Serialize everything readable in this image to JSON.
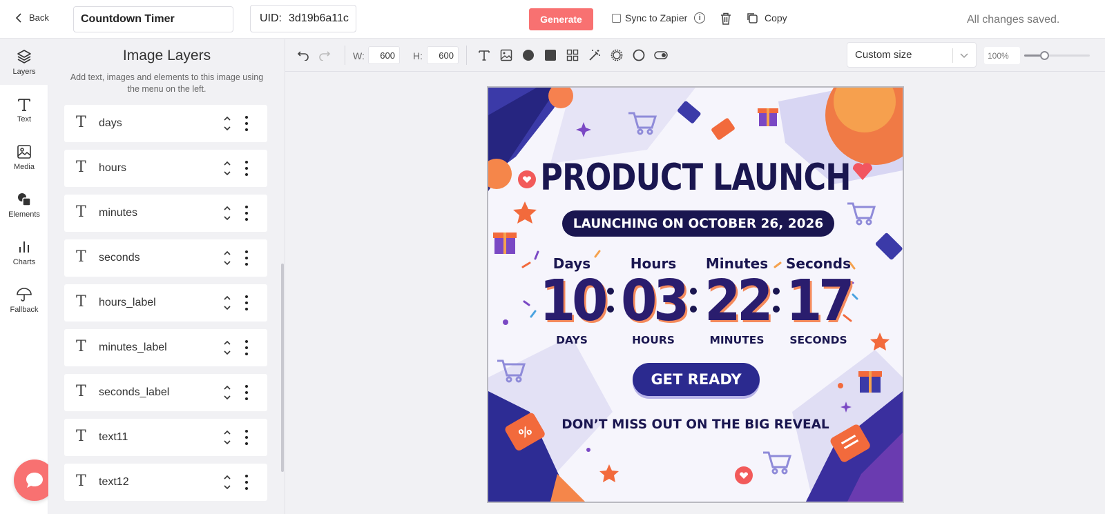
{
  "topbar": {
    "back_label": "Back",
    "title_value": "Countdown Timer",
    "uid_label": "UID:",
    "uid_value": "3d19b6a11c",
    "generate_label": "Generate",
    "sync_label": "Sync to Zapier",
    "copy_label": "Copy",
    "status": "All changes saved.",
    "accent_color": "#f87171"
  },
  "rail": {
    "items": [
      {
        "label": "Layers",
        "icon": "layers-icon"
      },
      {
        "label": "Text",
        "icon": "text-icon"
      },
      {
        "label": "Media",
        "icon": "image-icon"
      },
      {
        "label": "Elements",
        "icon": "shapes-icon"
      },
      {
        "label": "Charts",
        "icon": "bar-chart-icon"
      },
      {
        "label": "Fallback",
        "icon": "umbrella-icon"
      }
    ]
  },
  "panel": {
    "title": "Image Layers",
    "description": "Add text, images and elements to this image using the menu on the left.",
    "layers": [
      "days",
      "hours",
      "minutes",
      "seconds",
      "hours_label",
      "minutes_label",
      "seconds_label",
      "text11",
      "text12"
    ]
  },
  "toolbar": {
    "width_label": "W:",
    "width_value": "600",
    "height_label": "H:",
    "height_value": "600",
    "size_preset": "Custom size",
    "zoom": "100%",
    "zoom_fraction": 0.3
  },
  "artboard": {
    "title": "PRODUCT LAUNCH",
    "subtitle": "LAUNCHING ON OCTOBER 26, 2026",
    "units": [
      {
        "top": "Days",
        "value": "10",
        "bottom": "DAYS"
      },
      {
        "top": "Hours",
        "value": "03",
        "bottom": "HOURS"
      },
      {
        "top": "Minutes",
        "value": "22",
        "bottom": "MINUTES"
      },
      {
        "top": "Seconds",
        "value": "17",
        "bottom": "SECONDS"
      }
    ],
    "cta": "GET READY",
    "footer": "DON’T MISS OUT ON THE BIG REVEAL",
    "colors": {
      "navy": "#1a1650",
      "orange": "#f48a5c",
      "purple": "#2b2a8f"
    }
  }
}
